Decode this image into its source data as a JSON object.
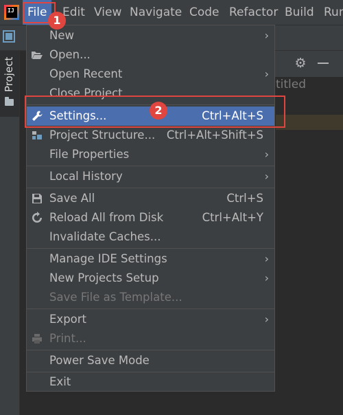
{
  "menubar": {
    "app_logo_text": "IJ",
    "items": [
      {
        "label": "File"
      },
      {
        "label": "Edit"
      },
      {
        "label": "View"
      },
      {
        "label": "Navigate"
      },
      {
        "label": "Code"
      },
      {
        "label": "Refactor"
      },
      {
        "label": "Build"
      },
      {
        "label": "Run"
      }
    ]
  },
  "tool_window": {
    "project_tab_label": "Project"
  },
  "background": {
    "untitled_text": "titled"
  },
  "file_menu": {
    "items": [
      {
        "label": "New",
        "shortcut": "",
        "submenu": true,
        "icon": ""
      },
      {
        "label": "Open...",
        "shortcut": "",
        "submenu": false,
        "icon": "folder-open-icon"
      },
      {
        "label": "Open Recent",
        "shortcut": "",
        "submenu": true,
        "icon": ""
      },
      {
        "label": "Close Project",
        "shortcut": "",
        "submenu": false,
        "icon": ""
      },
      {
        "label": "Settings...",
        "shortcut": "Ctrl+Alt+S",
        "submenu": false,
        "icon": "wrench-icon",
        "selected": true
      },
      {
        "label": "Project Structure...",
        "shortcut": "Ctrl+Alt+Shift+S",
        "submenu": false,
        "icon": "project-structure-icon"
      },
      {
        "label": "File Properties",
        "shortcut": "",
        "submenu": true,
        "icon": ""
      },
      {
        "label": "Local History",
        "shortcut": "",
        "submenu": true,
        "icon": ""
      },
      {
        "label": "Save All",
        "shortcut": "Ctrl+S",
        "submenu": false,
        "icon": "save-icon"
      },
      {
        "label": "Reload All from Disk",
        "shortcut": "Ctrl+Alt+Y",
        "submenu": false,
        "icon": "reload-icon"
      },
      {
        "label": "Invalidate Caches...",
        "shortcut": "",
        "submenu": false,
        "icon": ""
      },
      {
        "label": "Manage IDE Settings",
        "shortcut": "",
        "submenu": true,
        "icon": ""
      },
      {
        "label": "New Projects Setup",
        "shortcut": "",
        "submenu": true,
        "icon": ""
      },
      {
        "label": "Save File as Template...",
        "shortcut": "",
        "submenu": false,
        "icon": "",
        "disabled": true
      },
      {
        "label": "Export",
        "shortcut": "",
        "submenu": true,
        "icon": ""
      },
      {
        "label": "Print...",
        "shortcut": "",
        "submenu": false,
        "icon": "print-icon",
        "disabled": true
      },
      {
        "label": "Power Save Mode",
        "shortcut": "",
        "submenu": false,
        "icon": ""
      },
      {
        "label": "Exit",
        "shortcut": "",
        "submenu": false,
        "icon": ""
      }
    ],
    "submenu_arrow": "›"
  },
  "annotations": {
    "badge_1": "1",
    "badge_2": "2",
    "color": "#e0463f"
  },
  "colors": {
    "menu_bg": "#3c3f41",
    "selection": "#4b6eaf",
    "text": "#bbbbbb",
    "disabled_text": "#777777"
  }
}
